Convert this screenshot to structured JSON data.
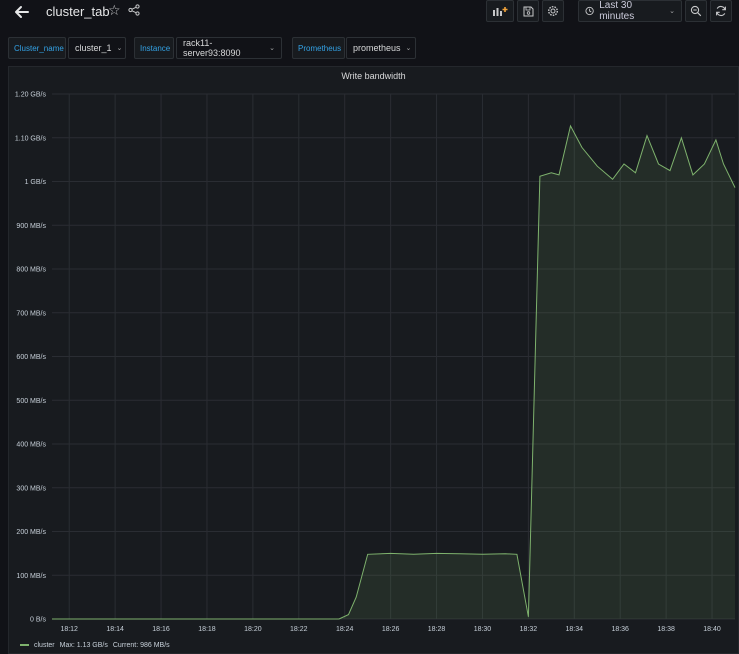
{
  "header": {
    "title": "cluster_tab",
    "time_range": "Last 30 minutes"
  },
  "variables": [
    {
      "label": "Cluster_name",
      "value": "cluster_1"
    },
    {
      "label": "Instance",
      "value": "rack11-server93:8090"
    },
    {
      "label": "Prometheus",
      "value": "prometheus"
    }
  ],
  "panel": {
    "title": "Write bandwidth"
  },
  "legend": {
    "series": "cluster",
    "max_label": "Max: 1.13 GB/s",
    "current_label": "Current: 986 MB/s"
  },
  "colors": {
    "series": "#7eb26d",
    "accent": "#33a2e5"
  },
  "chart_data": {
    "type": "area",
    "title": "Write bandwidth",
    "xlabel": "",
    "ylabel": "",
    "y_unit": "MB/s",
    "ylim": [
      0,
      1200
    ],
    "xlim": [
      "18:11:15",
      "18:41:00"
    ],
    "grid": true,
    "legend_position": "bottom-left",
    "y_ticks": [
      "0 B/s",
      "100 MB/s",
      "200 MB/s",
      "300 MB/s",
      "400 MB/s",
      "500 MB/s",
      "600 MB/s",
      "700 MB/s",
      "800 MB/s",
      "900 MB/s",
      "1 GB/s",
      "1.10 GB/s",
      "1.20 GB/s"
    ],
    "x_ticks": [
      "18:12",
      "18:14",
      "18:16",
      "18:18",
      "18:20",
      "18:22",
      "18:24",
      "18:26",
      "18:28",
      "18:30",
      "18:32",
      "18:34",
      "18:36",
      "18:38",
      "18:40"
    ],
    "series": [
      {
        "name": "cluster",
        "x": [
          "18:11:15",
          "18:23:45",
          "18:24:10",
          "18:24:30",
          "18:25:00",
          "18:26:00",
          "18:27:00",
          "18:28:00",
          "18:29:00",
          "18:30:00",
          "18:31:00",
          "18:31:30",
          "18:32:00",
          "18:32:30",
          "18:33:00",
          "18:33:20",
          "18:33:50",
          "18:34:20",
          "18:35:00",
          "18:35:40",
          "18:36:10",
          "18:36:40",
          "18:37:10",
          "18:37:40",
          "18:38:10",
          "18:38:40",
          "18:39:10",
          "18:39:40",
          "18:40:10",
          "18:40:30",
          "18:41:00"
        ],
        "values": [
          0,
          0,
          10,
          50,
          148,
          150,
          148,
          150,
          149,
          148,
          149,
          148,
          5,
          1012,
          1020,
          1015,
          1127,
          1078,
          1035,
          1005,
          1040,
          1020,
          1105,
          1040,
          1025,
          1100,
          1015,
          1040,
          1095,
          1040,
          986
        ]
      }
    ]
  }
}
